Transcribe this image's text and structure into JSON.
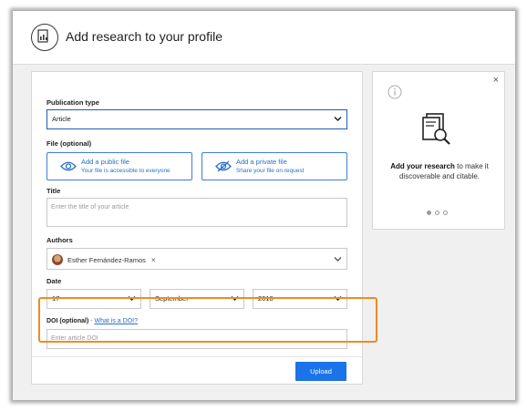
{
  "header": {
    "title": "Add research to your profile"
  },
  "form": {
    "publication_type": {
      "label": "Publication type",
      "value": "Article"
    },
    "file": {
      "label": "File (optional)",
      "public": {
        "title": "Add a public file",
        "subtitle": "Your file is accessible to everyone"
      },
      "private": {
        "title": "Add a private file",
        "subtitle": "Share your file on request"
      }
    },
    "title": {
      "label": "Title",
      "placeholder": "Enter the title of your article"
    },
    "authors": {
      "label": "Authors",
      "chips": [
        {
          "name": "Esther Fernández-Ramos"
        }
      ]
    },
    "date": {
      "label": "Date",
      "day": "17",
      "month": "September",
      "year": "2018"
    },
    "doi": {
      "label": "DOI (optional)",
      "separator": " - ",
      "link": "What is a DOI?",
      "placeholder": "Enter article DOI"
    },
    "upload_label": "Upload"
  },
  "side_panel": {
    "close": "×",
    "text_bold": "Add your research",
    "text_rest": " to make it discoverable and citable.",
    "slides": 3,
    "active_slide": 0
  },
  "colors": {
    "accent": "#1a73e8",
    "highlight": "#f08a24"
  }
}
